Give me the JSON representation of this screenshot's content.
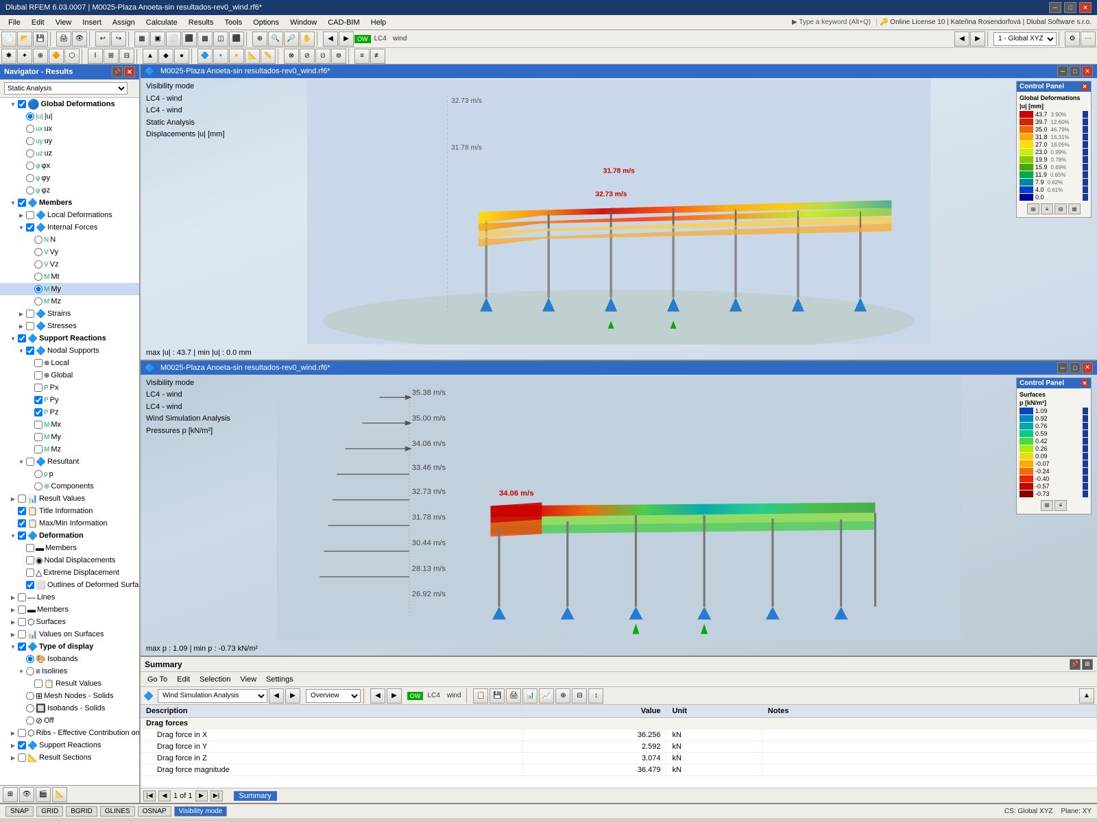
{
  "app": {
    "title": "Dlubal RFEM 6.03.0007 | M0025-Plaza Anoeta-sin resultados-rev0_wind.rf6*",
    "icon": "🔷"
  },
  "menu": {
    "items": [
      "File",
      "Edit",
      "View",
      "Insert",
      "Assign",
      "Calculate",
      "Results",
      "Tools",
      "Options",
      "Window",
      "CAD-BIM",
      "Help"
    ]
  },
  "toolbar1": {
    "type_label": "1 - Global XYZ",
    "lc_label": "LC4",
    "wind_label": "wind"
  },
  "navigator": {
    "title": "Navigator - Results",
    "dropdown_value": "Static Analysis",
    "sections": [
      {
        "label": "Global Deformations",
        "indent": 1,
        "has_checkbox": true,
        "checked": true,
        "expanded": true,
        "bold": true
      },
      {
        "label": "|u|",
        "indent": 2,
        "has_radio": true,
        "checked": true
      },
      {
        "label": "ux",
        "indent": 2,
        "has_radio": true
      },
      {
        "label": "uy",
        "indent": 2,
        "has_radio": true
      },
      {
        "label": "uz",
        "indent": 2,
        "has_radio": true
      },
      {
        "label": "φx",
        "indent": 2,
        "has_radio": true
      },
      {
        "label": "φy",
        "indent": 2,
        "has_radio": true
      },
      {
        "label": "φz",
        "indent": 2,
        "has_radio": true
      },
      {
        "label": "Members",
        "indent": 1,
        "has_checkbox": true,
        "checked": true,
        "expanded": true,
        "bold": true
      },
      {
        "label": "Local Deformations",
        "indent": 2,
        "has_checkbox": true
      },
      {
        "label": "Internal Forces",
        "indent": 2,
        "has_checkbox": true,
        "checked": true,
        "expanded": true
      },
      {
        "label": "N",
        "indent": 3,
        "has_radio": true
      },
      {
        "label": "Vy",
        "indent": 3,
        "has_radio": true
      },
      {
        "label": "Vz",
        "indent": 3,
        "has_radio": true
      },
      {
        "label": "Mt",
        "indent": 3,
        "has_radio": true
      },
      {
        "label": "My",
        "indent": 3,
        "has_radio": true,
        "checked": true
      },
      {
        "label": "Mz",
        "indent": 3,
        "has_radio": true
      },
      {
        "label": "Strains",
        "indent": 2,
        "has_checkbox": true
      },
      {
        "label": "Stresses",
        "indent": 2,
        "has_checkbox": true
      },
      {
        "label": "Support Reactions",
        "indent": 1,
        "has_checkbox": true,
        "checked": true,
        "expanded": true,
        "bold": true
      },
      {
        "label": "Nodal Supports",
        "indent": 2,
        "has_checkbox": true,
        "checked": true,
        "expanded": true
      },
      {
        "label": "Local",
        "indent": 3,
        "has_checkbox": true
      },
      {
        "label": "Global",
        "indent": 3,
        "has_checkbox": true
      },
      {
        "label": "Px",
        "indent": 3,
        "has_checkbox": true
      },
      {
        "label": "Py",
        "indent": 3,
        "has_checkbox": true,
        "checked": true
      },
      {
        "label": "Pz",
        "indent": 3,
        "has_checkbox": true,
        "checked": true
      },
      {
        "label": "Mx",
        "indent": 3,
        "has_checkbox": true
      },
      {
        "label": "My",
        "indent": 3,
        "has_checkbox": true
      },
      {
        "label": "Mz",
        "indent": 3,
        "has_checkbox": true
      },
      {
        "label": "Resultant",
        "indent": 2,
        "has_checkbox": true,
        "expanded": true
      },
      {
        "label": "p",
        "indent": 3,
        "has_radio": true
      },
      {
        "label": "Components",
        "indent": 3,
        "has_radio": true
      },
      {
        "label": "Result Values",
        "indent": 1,
        "has_checkbox": true
      },
      {
        "label": "Title Information",
        "indent": 1,
        "has_checkbox": true,
        "checked": true
      },
      {
        "label": "Max/Min Information",
        "indent": 1,
        "has_checkbox": true,
        "checked": true
      },
      {
        "label": "Deformation",
        "indent": 1,
        "has_checkbox": true,
        "checked": true,
        "expanded": true,
        "bold": true
      },
      {
        "label": "Members",
        "indent": 2,
        "has_checkbox": true
      },
      {
        "label": "Nodal Displacements",
        "indent": 2,
        "has_checkbox": true
      },
      {
        "label": "Extreme Displacement",
        "indent": 2,
        "has_checkbox": true
      },
      {
        "label": "Outlines of Deformed Surfaces",
        "indent": 2,
        "has_checkbox": true,
        "checked": true
      },
      {
        "label": "Lines",
        "indent": 1,
        "has_checkbox": true
      },
      {
        "label": "Members",
        "indent": 1,
        "has_checkbox": true
      },
      {
        "label": "Surfaces",
        "indent": 1,
        "has_checkbox": true
      },
      {
        "label": "Values on Surfaces",
        "indent": 1,
        "has_checkbox": true
      },
      {
        "label": "Type of display",
        "indent": 1,
        "has_checkbox": true,
        "checked": true,
        "expanded": true,
        "bold": true
      },
      {
        "label": "Isobands",
        "indent": 2,
        "has_radio": true,
        "checked": true
      },
      {
        "label": "Isolines",
        "indent": 2,
        "has_radio": true,
        "expanded": true
      },
      {
        "label": "Result Values",
        "indent": 3,
        "has_checkbox": true
      },
      {
        "label": "Mesh Nodes - Solids",
        "indent": 2,
        "has_radio": true
      },
      {
        "label": "Isobands - Solids",
        "indent": 2,
        "has_radio": true
      },
      {
        "label": "Off",
        "indent": 2,
        "has_radio": true
      },
      {
        "label": "Ribs - Effective Contribution on Sur...",
        "indent": 1,
        "has_checkbox": true
      },
      {
        "label": "Support Reactions",
        "indent": 1,
        "has_checkbox": true
      },
      {
        "label": "Result Sections",
        "indent": 1,
        "has_checkbox": true
      }
    ]
  },
  "viewport_top": {
    "title": "M0025-Plaza Anoeta-sin resultados-rev0_wind.rf6*",
    "info": {
      "line1": "Visibility mode",
      "line2": "LC4 - wind",
      "line3": "LC4 - wind",
      "line4": "Static Analysis",
      "line5": "Displacements |u| [mm]"
    },
    "status": "max |u| : 43.7 | min |u| : 0.0 mm",
    "legend": {
      "title": "Control Panel",
      "subtitle": "Global Deformations",
      "subtitle2": "|u| [mm]",
      "items": [
        {
          "value": "43.7",
          "pct": "3.90%",
          "color": "#cc0000"
        },
        {
          "value": "39.7",
          "pct": "12.60%",
          "color": "#dd2200"
        },
        {
          "value": "35.0",
          "pct": "46.79%",
          "color": "#ee6600"
        },
        {
          "value": "31.8",
          "pct": "16.31%",
          "color": "#ffaa00"
        },
        {
          "value": "27.0",
          "pct": "16.05%",
          "color": "#ffdd00"
        },
        {
          "value": "23.0",
          "pct": "0.99%",
          "color": "#ccee00"
        },
        {
          "value": "19.9",
          "pct": "0.78%",
          "color": "#88cc00"
        },
        {
          "value": "15.9",
          "pct": "0.69%",
          "color": "#44aa00"
        },
        {
          "value": "11.9",
          "pct": "0.65%",
          "color": "#00aa44"
        },
        {
          "value": "7.9",
          "pct": "0.62%",
          "color": "#0088aa"
        },
        {
          "value": "4.0",
          "pct": "0.61%",
          "color": "#0044cc"
        },
        {
          "value": "0.0",
          "pct": "",
          "color": "#0000aa"
        }
      ]
    }
  },
  "viewport_bottom": {
    "title": "M0025-Plaza Anoeta-sin resultados-rev0_wind.rf6*",
    "info": {
      "line1": "Visibility mode",
      "line2": "LC4 - wind",
      "line3": "LC4 - wind",
      "line4": "Wind Simulation Analysis",
      "line5": "Pressures p [kN/m²]"
    },
    "status": "max p : 1.09 | min p : -0.73 kN/m²",
    "wind_labels": [
      "35.38 m/s",
      "35.00 m/s",
      "34.06 m/s",
      "33.46 m/s",
      "32.73 m/s",
      "31.78 m/s",
      "30.44 m/s",
      "28.13 m/s",
      "26.92 m/s"
    ],
    "legend": {
      "title": "Control Panel",
      "subtitle": "Surfaces",
      "subtitle2": "p [kN/m²]",
      "items": [
        {
          "value": "1.09",
          "color": "#0044cc"
        },
        {
          "value": "0.92",
          "color": "#0088cc"
        },
        {
          "value": "0.76",
          "color": "#00aaaa"
        },
        {
          "value": "0.59",
          "color": "#00cc88"
        },
        {
          "value": "0.42",
          "color": "#44dd44"
        },
        {
          "value": "0.26",
          "color": "#aaee00"
        },
        {
          "value": "0.09",
          "color": "#eedd00"
        },
        {
          "value": "-0.07",
          "color": "#ffaa00"
        },
        {
          "value": "-0.24",
          "color": "#ff6600"
        },
        {
          "value": "-0.40",
          "color": "#ee2200"
        },
        {
          "value": "-0.57",
          "color": "#cc0000"
        },
        {
          "value": "-0.73",
          "color": "#880000"
        }
      ]
    }
  },
  "summary": {
    "title": "Summary",
    "menu_items": [
      "Go To",
      "Edit",
      "Selection",
      "View",
      "Settings"
    ],
    "analysis_dropdown": "Wind Simulation Analysis",
    "view_dropdown": "Overview",
    "lc_label": "LC4",
    "wind_label": "wind",
    "table_headers": [
      "Description",
      "Value",
      "Unit",
      "Notes"
    ],
    "sections": [
      {
        "group": "Drag forces",
        "rows": [
          {
            "description": "Drag force in X",
            "value": "36.256",
            "unit": "kN",
            "notes": ""
          },
          {
            "description": "Drag force in Y",
            "value": "2.592",
            "unit": "kN",
            "notes": ""
          },
          {
            "description": "Drag force in Z",
            "value": "3.074",
            "unit": "kN",
            "notes": ""
          },
          {
            "description": "Drag force magnitude",
            "value": "36.479",
            "unit": "kN",
            "notes": ""
          }
        ]
      }
    ],
    "pagination": "1 of 1",
    "tab_label": "Summary"
  },
  "statusbar": {
    "buttons": [
      "SNAP",
      "GRID",
      "BGRID",
      "GLINES",
      "OSNAP",
      "Visibility mode"
    ],
    "cs_label": "CS: Global XYZ",
    "plane_label": "Plane: XY"
  }
}
